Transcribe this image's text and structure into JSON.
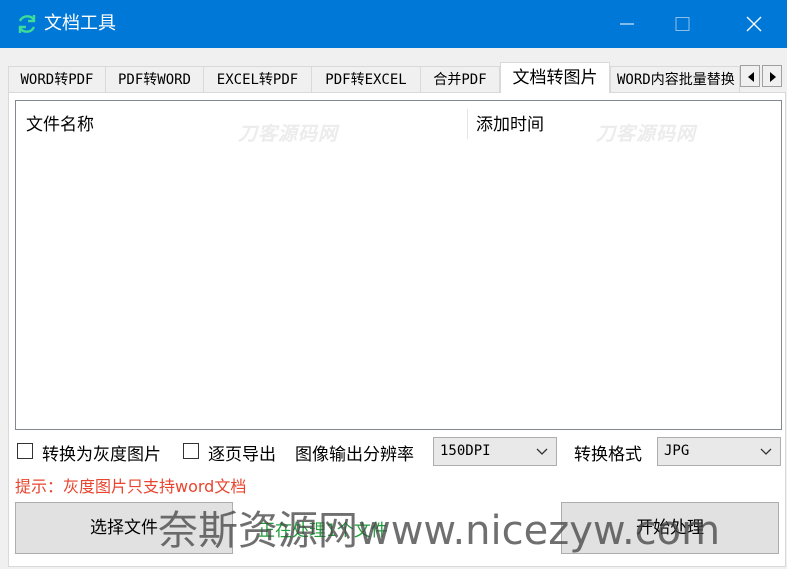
{
  "window": {
    "title": "文档工具",
    "accent_color": "#0078d7"
  },
  "tabs": [
    {
      "label": "WORD转PDF"
    },
    {
      "label": "PDF转WORD"
    },
    {
      "label": "EXCEL转PDF"
    },
    {
      "label": "PDF转EXCEL"
    },
    {
      "label": "合并PDF"
    },
    {
      "label": "文档转图片",
      "active": true
    },
    {
      "label": "WORD内容批量替换"
    }
  ],
  "file_list": {
    "columns": [
      "文件名称",
      "添加时间"
    ],
    "rows": [],
    "watermark": "刀客源码网"
  },
  "options": {
    "grayscale_label": "转换为灰度图片",
    "grayscale_checked": false,
    "per_page_label": "逐页导出",
    "per_page_checked": false,
    "resolution_label": "图像输出分辨率",
    "resolution_value": "150DPI",
    "format_label": "转换格式",
    "format_value": "JPG"
  },
  "hint": "提示：灰度图片只支持word文档",
  "buttons": {
    "select_files": "选择文件",
    "start": "开始处理"
  },
  "status": "正在处理1个文件",
  "overlay_watermark": "奈斯资源网www.nicezyw.com",
  "colors": {
    "hint": "#e8442e",
    "status": "#1f9e3a"
  }
}
